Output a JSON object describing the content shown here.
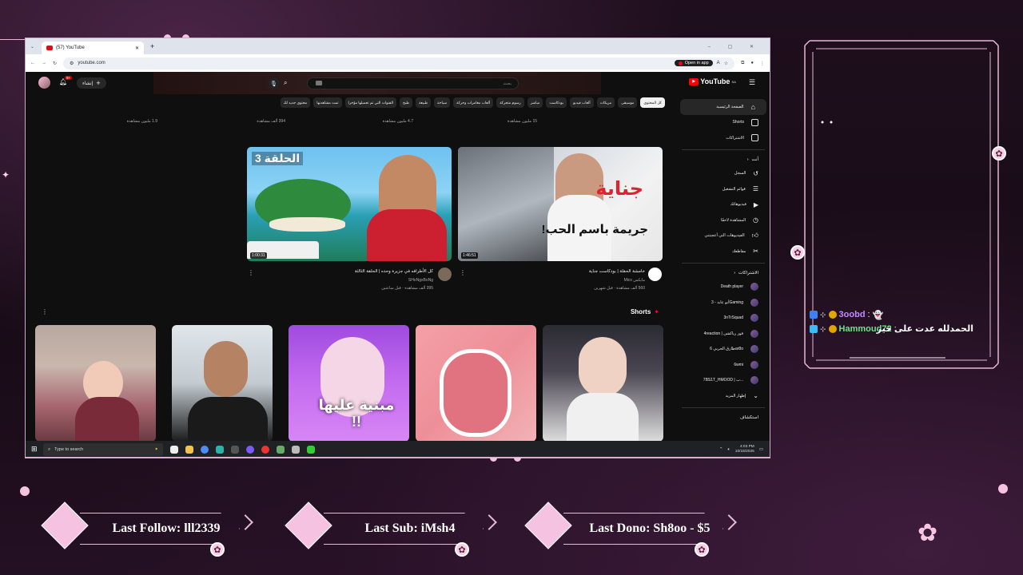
{
  "browser": {
    "tab_title": "(57) YouTube",
    "new_tab": "+",
    "url": "youtube.com",
    "open_in_app": "Open in app"
  },
  "youtube": {
    "logo": "YouTube",
    "country": "SA",
    "create_label": "إنشاء",
    "notifications_count": "9+",
    "search_placeholder": "بحث",
    "chips": [
      "كل المحتوى",
      "موسيقى",
      "مزيكات",
      "ألعاب فيديو",
      "بودكاست",
      "مباشر",
      "رسوم متحركة",
      "ألعاب مغامرات وحركة",
      "سياحة",
      "طبيعة",
      "طبخ",
      "الفنوات التي تم تحميلها مؤخرا",
      "تمت مشاهدتها",
      "محتوى جديد لك"
    ],
    "top_row_views": [
      "1.9 مليون مشاهدة",
      "394 ألف مشاهدة",
      "4.7 مليون مشاهدة",
      "15 مليون مشاهدة"
    ],
    "videos": [
      {
        "title": "خامشة الحقلة | بودكاست جناية",
        "channel": "مايكس Mics",
        "meta": "560 ألف مشاهدة · قبل شهرين",
        "duration": "1:46:51",
        "overlay_text": "جريمة باسم الحب!",
        "overlay_tag": "جناية"
      },
      {
        "title": "كل الأطرافه في جزيرة وحده | الحلقة الثالثة",
        "channel": "SHoNgxBoNg",
        "meta": "395 ألف مشاهدة · قبل ساعتين",
        "duration": "1:00:31",
        "overlay_text": "الحلقة 3"
      }
    ],
    "shorts_label": "Shorts",
    "shorts": [
      {
        "caption": ""
      },
      {
        "caption": ""
      },
      {
        "caption": "مبنية عليها !!"
      },
      {
        "caption": ""
      },
      {
        "caption": ""
      }
    ],
    "sidebar": {
      "main": [
        "الصفحة الرئيسية",
        "Shorts",
        "الاشتراكات"
      ],
      "you_header": "أنت",
      "you_items": [
        "السجل",
        "قوائم التشغيل",
        "فيديوهاتك",
        "المشاهدة لاحقًا",
        "الفيديوهات التي أعجبتني",
        "مقاطعك"
      ],
      "subs_header": "الاشتراكات",
      "subs": [
        "Death player",
        "أبو عابد - 3Gaming",
        "3nTrSquad",
        "4reaction | فور رياكشن",
        "طارق الحربي 6ar8o",
        "6wmi",
        "7BS1T_HMOOD | ب...",
        "إظهار المزيد"
      ],
      "explore_header": "استكشاف"
    }
  },
  "taskbar": {
    "search_placeholder": "Type to search",
    "time": "4:03 PM",
    "date": "10/15/2025"
  },
  "chat": [
    {
      "user": "3oobd",
      "user_color": "#c38bff",
      "message": "",
      "emote": "👻"
    },
    {
      "user": "Hammoud72",
      "user_color": "#6ee38a",
      "message": "الحمدلله عدت على خير"
    }
  ],
  "stream_labels": {
    "last_follow": "Last Follow: lll2339",
    "last_sub": "Last Sub: iMsh4",
    "last_dono": "Last Dono: Sh8oo - $5"
  },
  "colors": {
    "accent_pink": "#f6c2e1",
    "yt_red": "#ff0000",
    "frame_line": "#e7b7d5"
  }
}
